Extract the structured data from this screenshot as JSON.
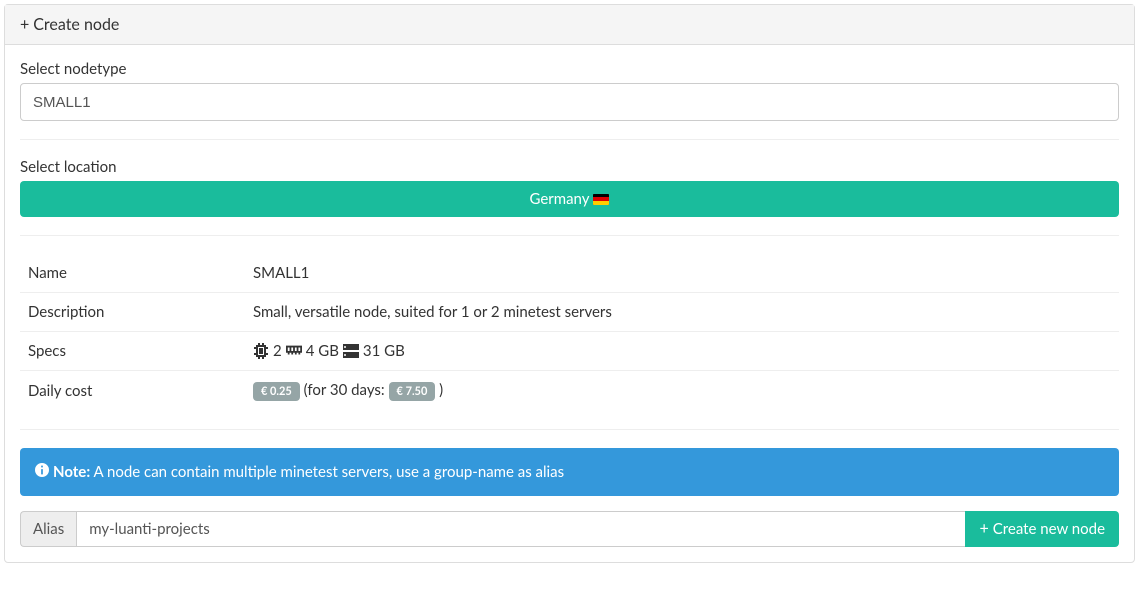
{
  "header": {
    "title": "Create node"
  },
  "form": {
    "nodetype_label": "Select nodetype",
    "nodetype_value": "SMALL1",
    "location_label": "Select location",
    "location_button": "Germany",
    "alias_label": "Alias",
    "alias_value": "my-luanti-projects",
    "submit_label": "Create new node"
  },
  "details": {
    "name_label": "Name",
    "name_value": "SMALL1",
    "description_label": "Description",
    "description_value": "Small, versatile node, suited for 1 or 2 minetest servers",
    "specs_label": "Specs",
    "specs": {
      "cpu": "2",
      "memory": "4 GB",
      "disk": "31 GB"
    },
    "cost_label": "Daily cost",
    "cost": {
      "daily": "€ 0.25",
      "period_prefix": "(for 30 days:",
      "monthly": "€ 7.50",
      "period_suffix": ")"
    }
  },
  "note": {
    "label": "Note:",
    "text": "A node can contain multiple minetest servers, use a group-name as alias"
  }
}
